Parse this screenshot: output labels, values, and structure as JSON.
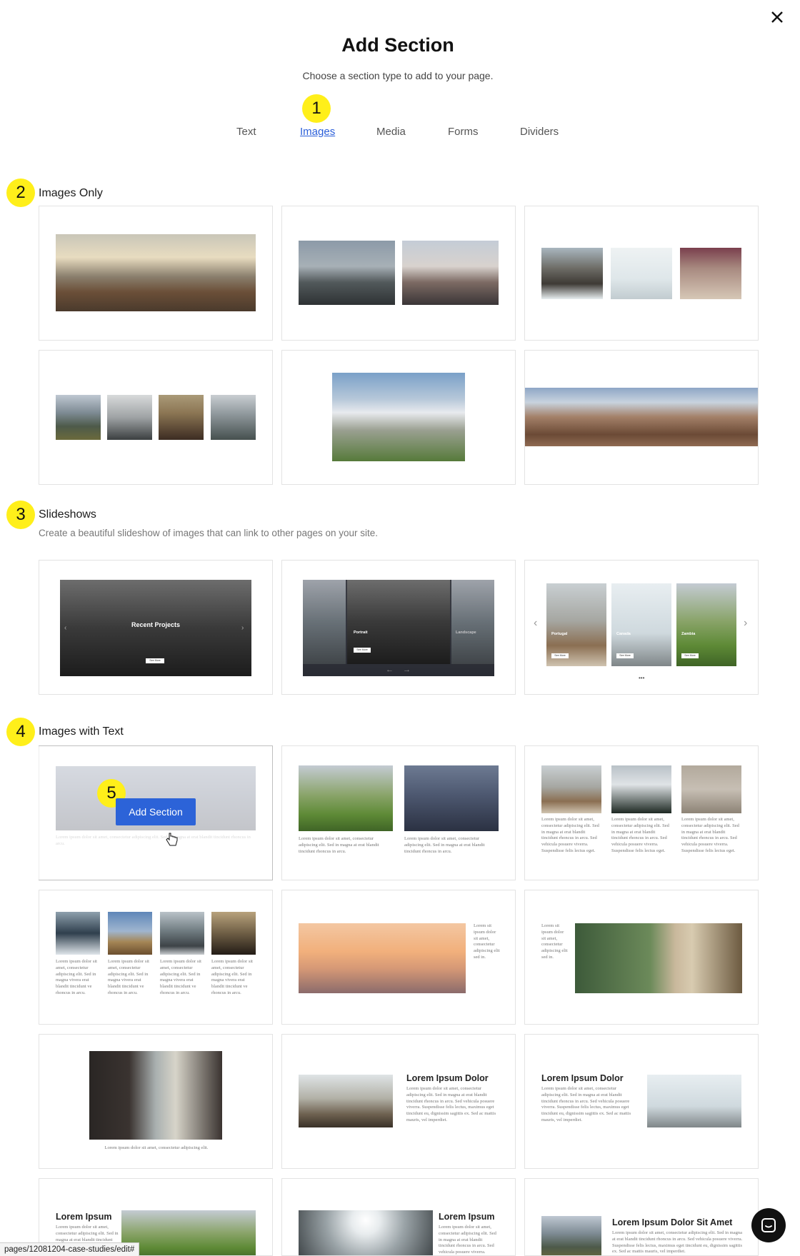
{
  "header": {
    "title": "Add Section",
    "subtitle": "Choose a section type to add to your page.",
    "close_icon": "close-icon"
  },
  "tabs": [
    {
      "label": "Text",
      "active": false
    },
    {
      "label": "Images",
      "active": true
    },
    {
      "label": "Media",
      "active": false
    },
    {
      "label": "Forms",
      "active": false
    },
    {
      "label": "Dividers",
      "active": false
    }
  ],
  "markers": [
    "1",
    "2",
    "3",
    "4",
    "5"
  ],
  "sections": {
    "images_only": {
      "title": "Images Only"
    },
    "slideshows": {
      "title": "Slideshows",
      "description": "Create a beautiful slideshow of images that can link to other pages on your site."
    },
    "images_with_text": {
      "title": "Images with Text"
    }
  },
  "slideshow_cards": {
    "projects_title": "Recent Projects",
    "portrait_label": "Portrait",
    "landscape_label": "Landscape",
    "countries": [
      "Portugal",
      "Canada",
      "Zambia"
    ],
    "button": "See More"
  },
  "lorem": {
    "short": "Lorem ipsum dolor sit amet, consectetur adipiscing elit. Sed in magna at erat blandit tincidunt rhoncus in arcu.",
    "column": "Lorem ipsum dolor sit amet, consectetur adipiscing elit. Sed in magna at erat blandit tincidunt rhoncus in arcu. Sed vehicula posuere viverra. Suspendisse felis lectus eget.",
    "narrow": "Lorem ipsum dolor sit amet, consectetur adipiscing elit. Sed in magna vivera erat blandit tincidunt ve rhoncus in arcu.",
    "side": "Lorem sit ipsum dolor sit amet, consectetur adipiscing elit sed in.",
    "caption": "Lorem ipsum dolor sit amet, consectetur adipiscing elit.",
    "para": "Lorem ipsum dolor sit amet, consectetur adipiscing elit. Sed in magna at erat blandit tincidunt rhoncus in arcu. Sed vehicula posuere viverra. Suspendisse felis lectus, maximus eget tincidunt eu, dignissim sagittis ex. Sed ac mattis mauris, vel imperdiet."
  },
  "text_heads": {
    "dolor": "Lorem Ipsum Dolor",
    "ipsum": "Lorem Ipsum",
    "amet": "Lorem Ipsum Dolor Sit Amet"
  },
  "hover_card": {
    "button_label": "Add Section"
  },
  "status_bar": {
    "url": "pages/12081204-case-studies/edit#"
  },
  "chat": {
    "icon": "chat-icon"
  }
}
